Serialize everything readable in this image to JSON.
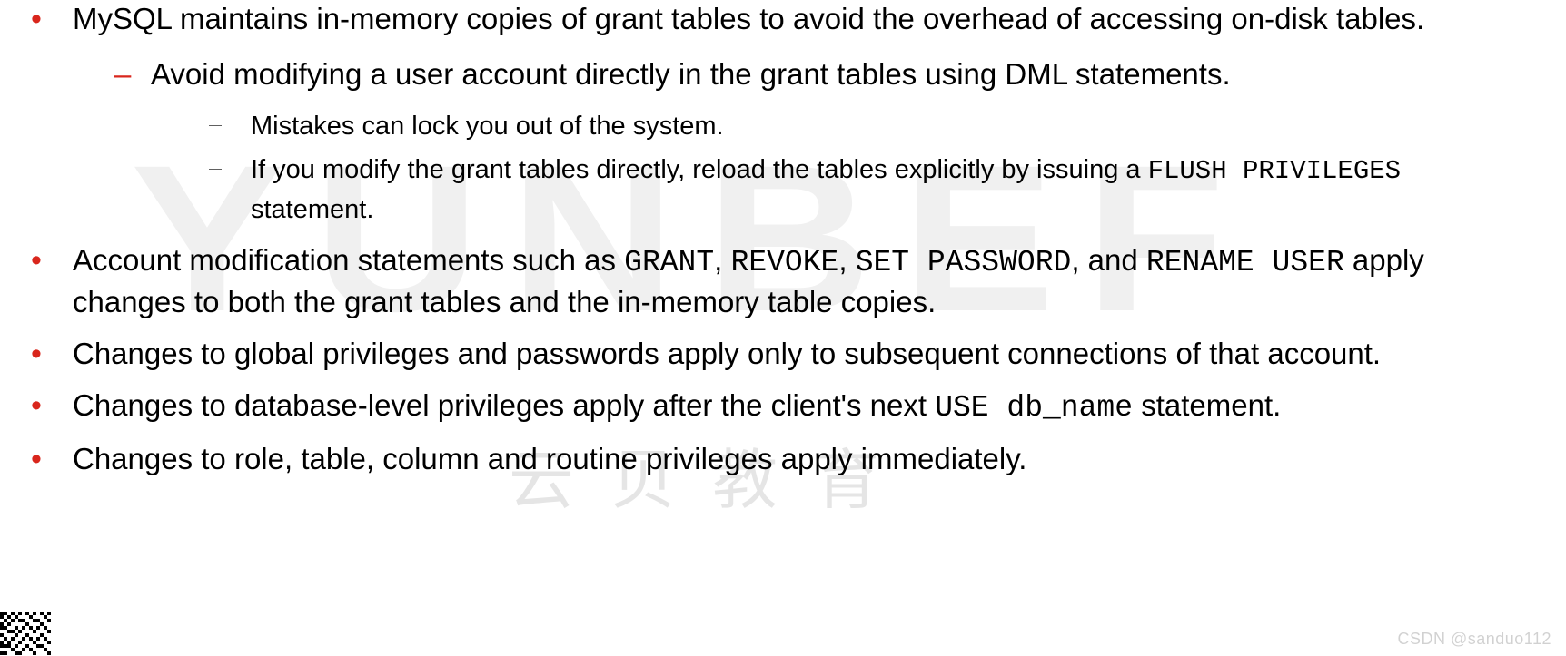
{
  "watermarks": {
    "big": "YUNBEF",
    "cn": "云贝教育"
  },
  "attribution": "CSDN @sanduo112",
  "bullets": {
    "b1": {
      "text": "MySQL maintains in-memory copies of grant tables to avoid the overhead of accessing on-disk tables.",
      "sub1": {
        "s1": {
          "text": "Avoid modifying a user account directly in the grant tables using DML statements.",
          "sub2": {
            "t1": "Mistakes can lock you out of the system.",
            "t2_a": "If you modify the grant tables directly, reload the tables explicitly by issuing a ",
            "t2_code1": "FLUSH PRIVILEGES",
            "t2_b": " statement."
          }
        }
      }
    },
    "b2": {
      "a": "Account modification statements such as ",
      "code1": "GRANT",
      "sep1": ", ",
      "code2": "REVOKE",
      "sep2": ", ",
      "code3": "SET PASSWORD",
      "sep3": ", and ",
      "code4": "RENAME USER",
      "b": " apply changes to both the grant tables and the in-memory table copies."
    },
    "b3": "Changes to global privileges and passwords apply only to subsequent connections of that account.",
    "b4": {
      "a": "Changes to database-level privileges apply after the client's next ",
      "code1": "USE db_name",
      "b": " statement."
    },
    "b5": "Changes to role, table, column and routine privileges apply immediately."
  }
}
